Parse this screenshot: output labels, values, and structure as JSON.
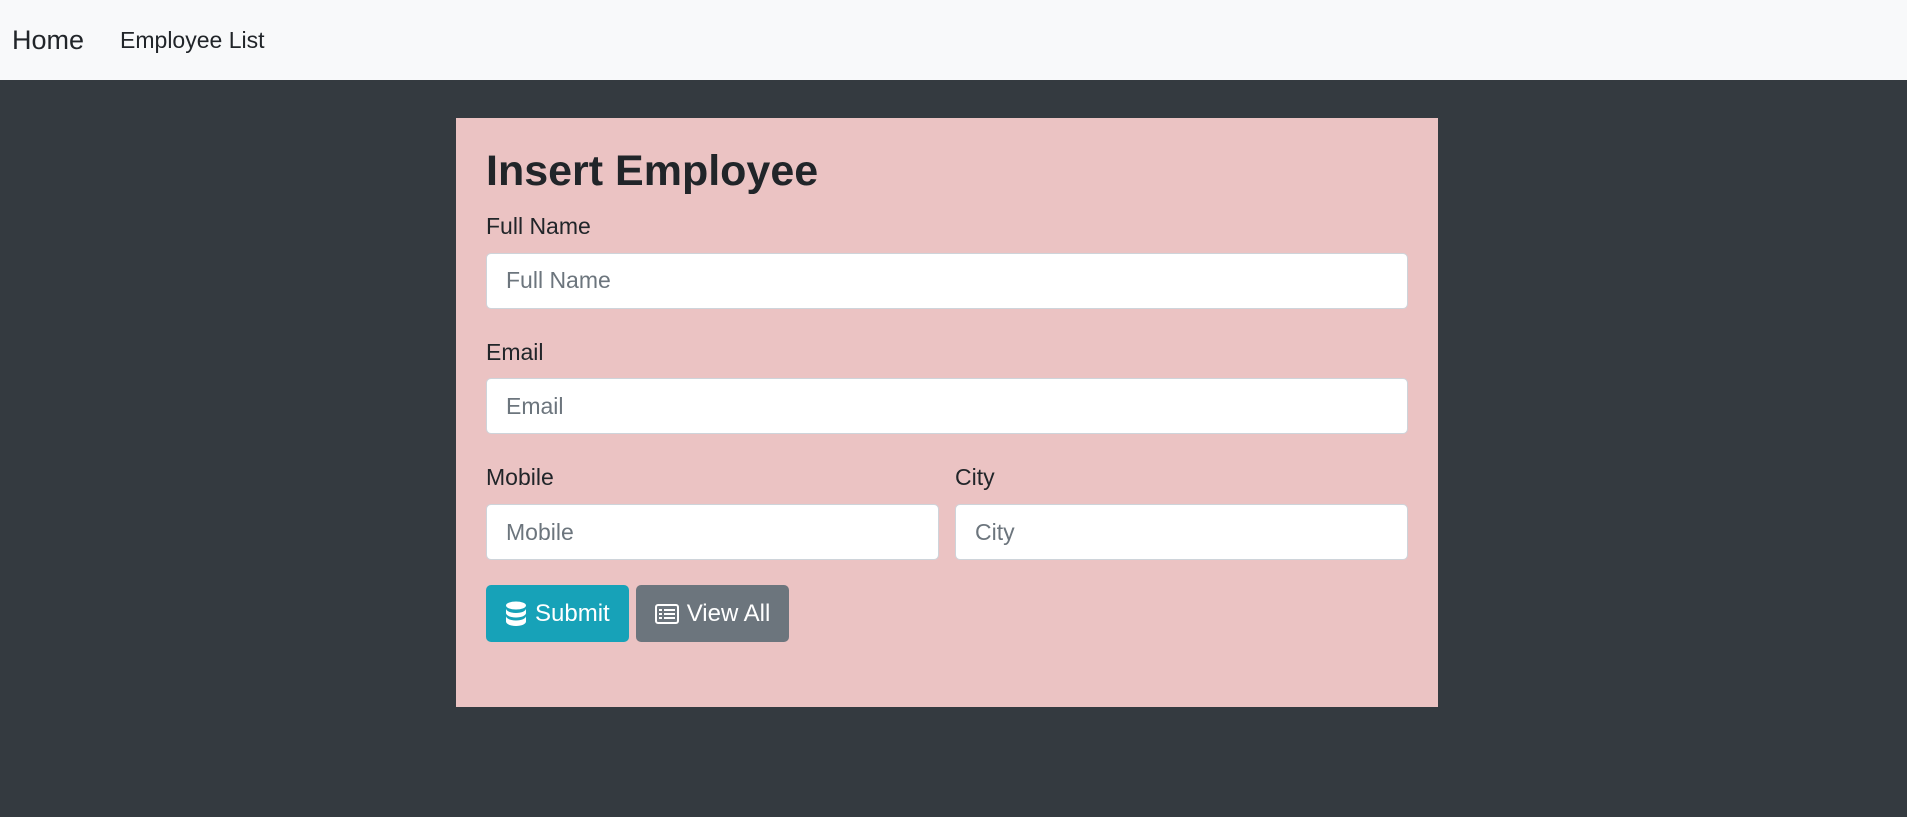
{
  "nav": {
    "brand": "Home",
    "links": [
      {
        "label": "Employee List"
      }
    ]
  },
  "form": {
    "title": "Insert Employee",
    "fields": {
      "full_name": {
        "label": "Full Name",
        "placeholder": "Full Name",
        "value": ""
      },
      "email": {
        "label": "Email",
        "placeholder": "Email",
        "value": ""
      },
      "mobile": {
        "label": "Mobile",
        "placeholder": "Mobile",
        "value": ""
      },
      "city": {
        "label": "City",
        "placeholder": "City",
        "value": ""
      }
    },
    "buttons": {
      "submit": {
        "label": "Submit",
        "icon": "database-icon"
      },
      "view_all": {
        "label": "View All",
        "icon": "list-alt-icon"
      }
    }
  },
  "colors": {
    "navbar_bg": "#f8f9fa",
    "page_bg": "#343a40",
    "card_bg": "#ebc3c3",
    "submit_btn": "#17a2b8",
    "view_all_btn": "#6c757d"
  }
}
